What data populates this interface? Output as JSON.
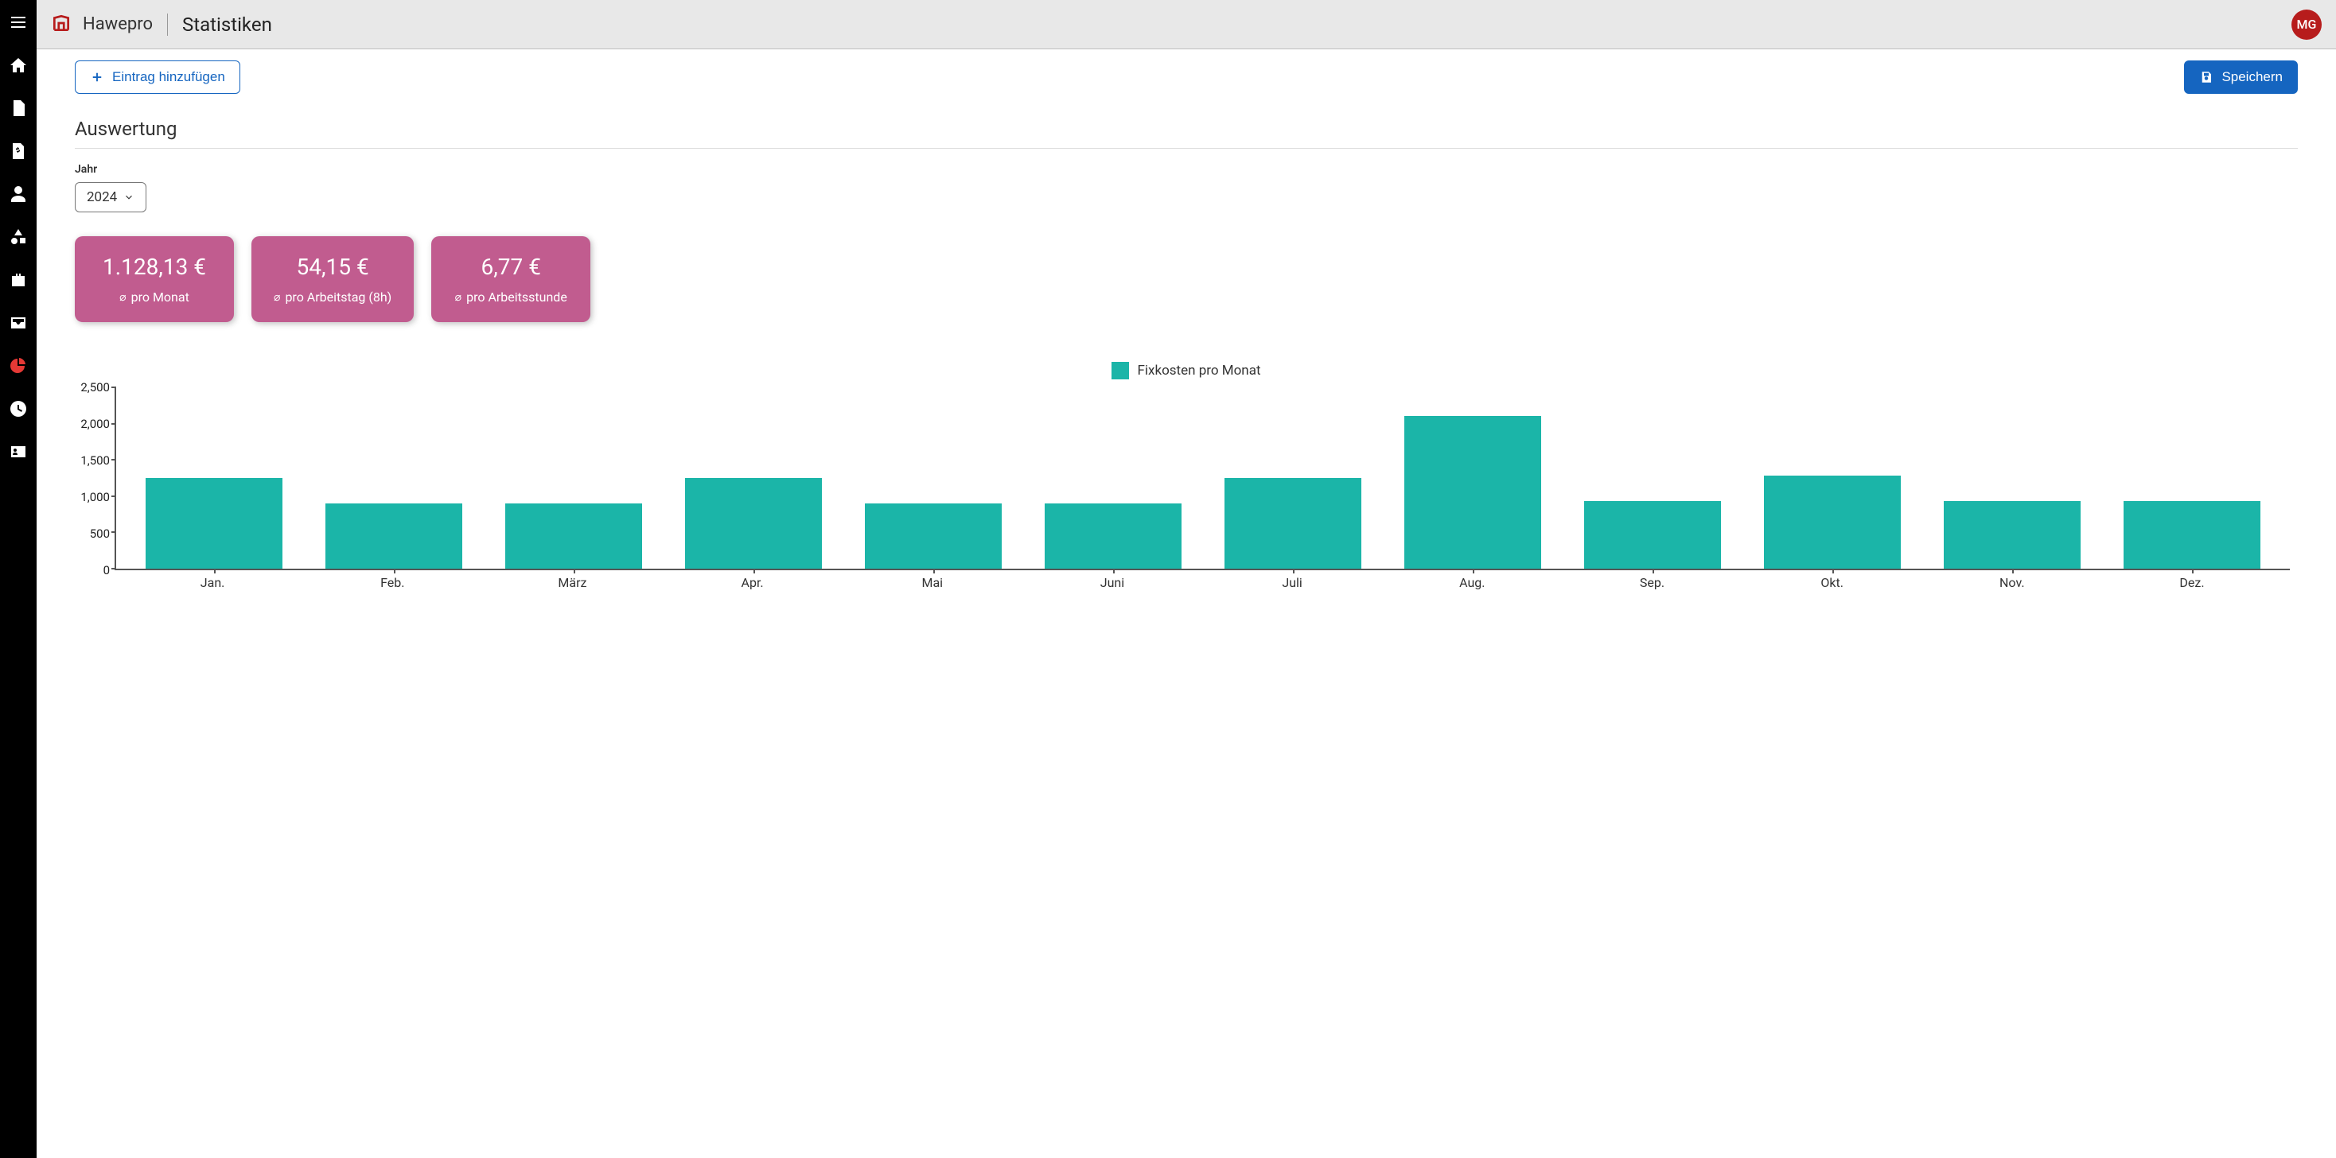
{
  "brand": "Hawepro",
  "page_title": "Statistiken",
  "avatar_initials": "MG",
  "actions": {
    "add_label": "Eintrag hinzufügen",
    "save_label": "Speichern"
  },
  "section_title": "Auswertung",
  "year": {
    "label": "Jahr",
    "value": "2024"
  },
  "cards": [
    {
      "value": "1.128,13 €",
      "label": "pro Monat"
    },
    {
      "value": "54,15 €",
      "label": "pro Arbeitstag (8h)"
    },
    {
      "value": "6,77 €",
      "label": "pro Arbeitsstunde"
    }
  ],
  "legend": "Fixkosten pro Monat",
  "chart_data": {
    "type": "bar",
    "title": "",
    "xlabel": "",
    "ylabel": "",
    "ylim": [
      0,
      2500
    ],
    "yticks": [
      0,
      500,
      1000,
      1500,
      2000,
      2500
    ],
    "categories": [
      "Jan.",
      "Feb.",
      "März",
      "Apr.",
      "Mai",
      "Juni",
      "Juli",
      "Aug.",
      "Sep.",
      "Okt.",
      "Nov.",
      "Dez."
    ],
    "series": [
      {
        "name": "Fixkosten pro Monat",
        "color": "#1bb5a8",
        "values": [
          1250,
          900,
          900,
          1250,
          900,
          900,
          1250,
          2100,
          930,
          1280,
          930,
          930
        ]
      }
    ]
  }
}
